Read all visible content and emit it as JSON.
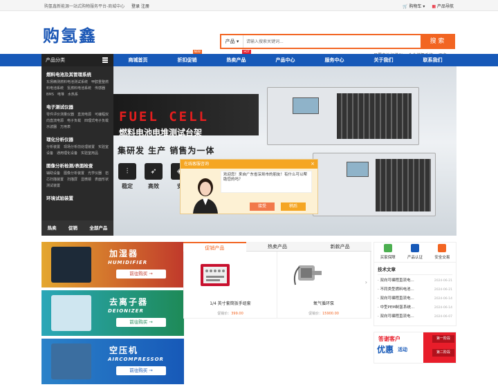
{
  "topbar": {
    "slogan": "购氢鑫新能源一站式购物服务平台-商城中心",
    "login": "登录",
    "register": "注册",
    "cart": "购物车",
    "product_nav": "产品导航"
  },
  "header": {
    "logo": "购氢鑫",
    "search_category": "产品",
    "search_placeholder": "请输入搜索关键词...",
    "search_button": "搜 索",
    "hot_keywords": [
      "日置电池扫描仪",
      "合金储氢系统",
      "更多..."
    ]
  },
  "nav": {
    "category_title": "产品分类",
    "items": [
      {
        "label": "商城首页",
        "badge": ""
      },
      {
        "label": "折扣促销",
        "badge": "NEW"
      },
      {
        "label": "热卖产品",
        "badge": "HOT"
      },
      {
        "label": "产品中心",
        "badge": ""
      },
      {
        "label": "服务中心",
        "badge": ""
      },
      {
        "label": "关于我们",
        "badge": ""
      },
      {
        "label": "联系我们",
        "badge": ""
      }
    ]
  },
  "sidebar": {
    "groups": [
      {
        "title": "燃料电池及其管理系统",
        "items": "东扬精测燃料电池测试系统　甲醇重整燃料电池系统　氢燃料电池系统　传感器　BMS　电堆　水热系"
      },
      {
        "title": "电子测试仪器",
        "items": "零件评价测量仪器　直流电源　可编程双向直流电源　电子负载　四理式电子负载　示波器　万用表"
      },
      {
        "title": "理化分析仪器",
        "items": "分析装置　现场分析前处理装置　实验室设备　通用理化设备　实验室用品"
      },
      {
        "title": "图像分析检测/表面检查",
        "items": "辅助设备　图像分析装置　光学仪器　岩芯扫描装置　扫描屏　显微镜　表面形状测试装置"
      },
      {
        "title": "环境试验装置",
        "items": ""
      }
    ],
    "bottom": [
      "热卖",
      "促销",
      "全部产品"
    ]
  },
  "banner": {
    "headline": "FUEL CELL",
    "subtitle": "燃料电池电堆测试台架",
    "slogan": "集研发 生产 销售为一体",
    "features": [
      "稳定",
      "高效",
      "安"
    ]
  },
  "chat": {
    "title": "在线客服咨询",
    "close": "×",
    "message": "欢迎您！来自广东省深圳市的朋友！有什么可以帮助您的吗？",
    "accept": "接受",
    "later": "稍后"
  },
  "ads": [
    {
      "cn": "加湿器",
      "en": "HUMIDIFIER",
      "go": "前往购买 →",
      "color": "#c0392b"
    },
    {
      "cn": "去离子器",
      "en": "DEIONIZER",
      "go": "前往购买 →",
      "color": "#1e8a57"
    },
    {
      "cn": "空压机",
      "en": "AIRCOMPRESSOR",
      "go": "前往购买 →",
      "color": "#1759b8"
    }
  ],
  "tabs": {
    "labels": [
      "促销产品",
      "热卖产品",
      "新款产品"
    ],
    "products": [
      {
        "name": "1/4 英寸套筒扳手组套",
        "price_label": "促销价：",
        "price": "399.00"
      },
      {
        "name": "氧气循环泵",
        "price_label": "促销价：",
        "price": "15900.00"
      }
    ]
  },
  "rside": {
    "badges": [
      "买家保障",
      "产品认证",
      "安全交易"
    ],
    "news_title": "技术文章",
    "news": [
      {
        "title": "· 双向可编程直流电...",
        "date": "2024-06-21"
      },
      {
        "title": "· 不同类型燃料电池...",
        "date": "2024-06-21"
      },
      {
        "title": "· 双向可编程直流电...",
        "date": "2024-06-14"
      },
      {
        "title": "· 中型PEM制氢系统...",
        "date": "2024-06-14"
      },
      {
        "title": "· 双向可编程直流电...",
        "date": "2024-06-07"
      }
    ],
    "promo": {
      "line1": "答谢客户",
      "line2": "优惠",
      "line3": "活动",
      "stage1": "第一阶段",
      "stage2": "第二阶段"
    }
  }
}
